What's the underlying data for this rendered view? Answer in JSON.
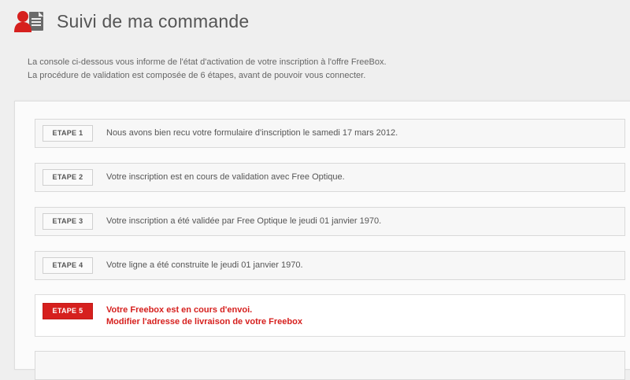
{
  "header": {
    "title": "Suivi de ma commande"
  },
  "intro": {
    "line1": "La console ci-dessous vous informe de l'état d'activation de votre inscription à l'offre FreeBox.",
    "line2": "La procédure de validation est composée de 6 étapes, avant de pouvoir vous connecter."
  },
  "steps": [
    {
      "label": "ETAPE 1",
      "text": "Nous avons bien recu votre formulaire d'inscription le samedi 17 mars 2012.",
      "status": "done"
    },
    {
      "label": "ETAPE 2",
      "text": "Votre inscription est en cours de validation avec Free Optique.",
      "status": "done"
    },
    {
      "label": "ETAPE 3",
      "text": "Votre inscription a été validée par Free Optique le jeudi 01 janvier 1970.",
      "status": "done"
    },
    {
      "label": "ETAPE 4",
      "text": "Votre ligne a été construite le jeudi 01 janvier 1970.",
      "status": "done"
    },
    {
      "label": "ETAPE 5",
      "text": "Votre Freebox est en cours d'envoi.",
      "link": "Modifier l'adresse de livraison de votre Freebox",
      "status": "active"
    }
  ],
  "colors": {
    "accent": "#d6201e",
    "background": "#efefef"
  },
  "icons": {
    "header": "user-document-icon"
  }
}
